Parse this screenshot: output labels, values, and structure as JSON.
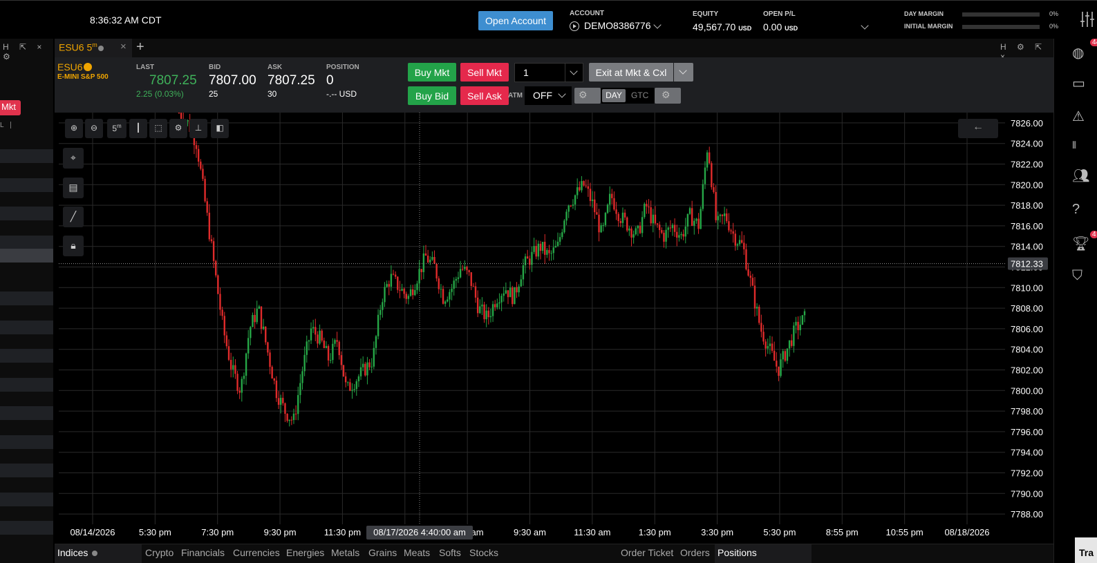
{
  "topbar": {
    "clock": "8:36:32 AM CDT",
    "open_account_label": "Open Account",
    "account_label": "ACCOUNT",
    "account_value": "DEMO8386776",
    "equity_label": "EQUITY",
    "equity_value": "49,567.70",
    "equity_unit": "USD",
    "openpl_label": "OPEN P/L",
    "openpl_value": "0.00",
    "openpl_unit": "USD",
    "day_margin_label": "DAY MARGIN",
    "day_margin_pct": "0%",
    "initial_margin_label": "INITIAL MARGIN",
    "initial_margin_pct": "0%"
  },
  "left_panel": {
    "mkt_label": "Mkt",
    "header_fragment": "L"
  },
  "tab": {
    "label": "ESU6 5",
    "superscript": "m",
    "close": "×",
    "add": "+"
  },
  "ticket": {
    "symbol": "ESU6",
    "description": "E-MINI S&P 500",
    "last_label": "LAST",
    "last_value": "7807.25",
    "last_change": "2.25 (0.03%)",
    "bid_label": "BID",
    "bid_value": "7807.00",
    "bid_size": "25",
    "ask_label": "ASK",
    "ask_value": "7807.25",
    "ask_size": "30",
    "position_label": "POSITION",
    "position_value": "0",
    "position_usd": "-.-- USD",
    "buy_mkt": "Buy Mkt",
    "sell_mkt": "Sell Mkt",
    "buy_bid": "Buy Bid",
    "sell_ask": "Sell Ask",
    "quantity": "1",
    "exit_label": "Exit at Mkt & Cxl",
    "atm_label": "ATM",
    "atm_value": "OFF",
    "tif_day": "DAY",
    "tif_gtc": "GTC"
  },
  "chart": {
    "interval_label": "5",
    "interval_sup": "m",
    "price_line_label": "7812.33",
    "cursor_date": "08/17/2026 4:40:00 am",
    "colors": {
      "up": "#26a747",
      "down": "#e02b2b",
      "grid": "#2a2a2a",
      "axis_text": "#ffffff"
    }
  },
  "chart_data": {
    "type": "candlestick",
    "ylim": [
      7787,
      7827
    ],
    "y_ticks": [
      "7826.00",
      "7824.00",
      "7822.00",
      "7820.00",
      "7818.00",
      "7816.00",
      "7814.00",
      "7812.00",
      "7810.00",
      "7808.00",
      "7806.00",
      "7804.00",
      "7802.00",
      "7800.00",
      "7798.00",
      "7796.00",
      "7794.00",
      "7792.00",
      "7790.00",
      "7788.00"
    ],
    "x_ticks": [
      "08/14/2026",
      "5:30 pm",
      "7:30 pm",
      "9:30 pm",
      "11:30 pm",
      "08/15/",
      "7:30 am",
      "9:30 am",
      "11:30 am",
      "1:30 pm",
      "3:30 pm",
      "5:30 pm",
      "8:55 pm",
      "10:55 pm",
      "08/18/2026"
    ],
    "price_line": 7812.33,
    "close_path": [
      7827,
      7826,
      7824,
      7818,
      7812,
      7806,
      7802,
      7800,
      7806,
      7808,
      7804,
      7800,
      7798,
      7797,
      7802,
      7806,
      7805,
      7803,
      7805,
      7800,
      7801,
      7802,
      7803,
      7809,
      7811,
      7810,
      7809,
      7811,
      7813,
      7812,
      7809,
      7810,
      7812,
      7811,
      7808,
      7807,
      7809,
      7810,
      7809,
      7812,
      7813,
      7814,
      7813,
      7814,
      7818,
      7819,
      7820,
      7818,
      7815,
      7819,
      7817,
      7816,
      7815,
      7818,
      7816,
      7815,
      7816,
      7815,
      7817,
      7816,
      7824,
      7816,
      7817,
      7815,
      7814,
      7810,
      7806,
      7804,
      7802,
      7804,
      7806,
      7807
    ]
  },
  "bottom_tabs": {
    "indices": "Indices",
    "crypto": "Crypto",
    "financials": "Financials",
    "currencies": "Currencies",
    "energies": "Energies",
    "metals": "Metals",
    "grains": "Grains",
    "meats": "Meats",
    "softs": "Softs",
    "stocks": "Stocks",
    "order_ticket": "Order Ticket",
    "orders": "Orders",
    "positions": "Positions",
    "tra": "Tra"
  },
  "right_rail": {
    "badge_top": "44",
    "badge_trophy": "4"
  }
}
